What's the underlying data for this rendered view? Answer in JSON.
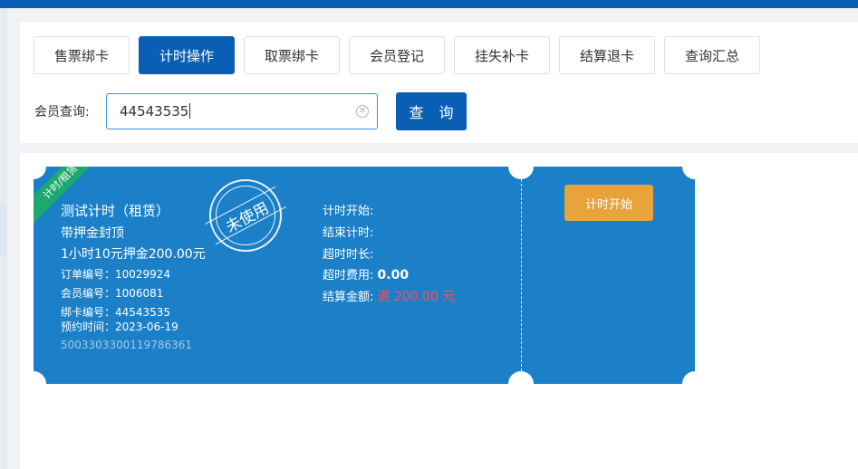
{
  "tabs": [
    {
      "label": "售票绑卡",
      "active": false
    },
    {
      "label": "计时操作",
      "active": true
    },
    {
      "label": "取票绑卡",
      "active": false
    },
    {
      "label": "会员登记",
      "active": false
    },
    {
      "label": "挂失补卡",
      "active": false
    },
    {
      "label": "结算退卡",
      "active": false
    },
    {
      "label": "查询汇总",
      "active": false
    }
  ],
  "query": {
    "label": "会员查询:",
    "value": "44543535",
    "button_label": "查 询"
  },
  "ticket": {
    "ribbon": "计时/租赁",
    "stamp": "未使用",
    "title": "测试计时（租赁）",
    "subtitle": "带押金封顶",
    "price_line": "1小时10元押金200.00元",
    "order_no": "订单编号：10029924",
    "member_no": "会员编号：1006081",
    "card_no": "绑卡编号：44543535",
    "reserve_time": "预约时间：2023-06-19",
    "code": "5003303300119786361",
    "fields": {
      "start_label": "计时开始:",
      "end_label": "结束计时:",
      "overtime_label": "超时时长:",
      "overtime_fee_label": "超时费用:",
      "overtime_fee_value": "0.00",
      "settle_label": "结算金额:",
      "settle_value": "退 200.00 元"
    },
    "action_label": "计时开始"
  }
}
